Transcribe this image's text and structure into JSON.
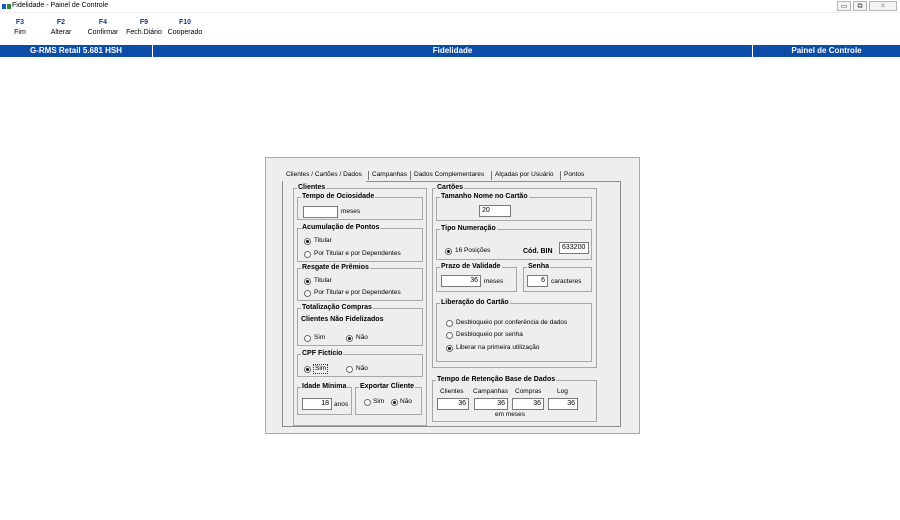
{
  "window": {
    "title": "Fidelidade - Painel de Controle",
    "minimize_glyph": "▭",
    "maximize_glyph": "⧉",
    "close_glyph": "✕"
  },
  "toolbar": {
    "keys": [
      {
        "key": "F3",
        "label": "Fim"
      },
      {
        "key": "F2",
        "label": "Alterar"
      },
      {
        "key": "F4",
        "label": "Confirmar"
      },
      {
        "key": "F9",
        "label": "Fech.Diário"
      },
      {
        "key": "F10",
        "label": "Cooperado"
      }
    ]
  },
  "statusbar": {
    "left": "G-RMS Retail 5.681 HSH",
    "center": "Fidelidade",
    "right": "Painel de Controle",
    "color": "#0d4da8"
  },
  "tabs": [
    "Clientes / Cartões / Dados",
    "Campanhas",
    "Dados Complementares",
    "Alçadas por Usuário",
    "Pontos"
  ],
  "clientes": {
    "legend": "Clientes",
    "ociosidade": {
      "legend": "Tempo de Ociosidade",
      "value": "",
      "unit": "meses"
    },
    "acumulacao": {
      "legend": "Acumulação de Pontos",
      "options": [
        "Titular",
        "Por Titular e por Dependentes"
      ],
      "selected": 0
    },
    "resgate": {
      "legend": "Resgate de Prêmios",
      "options": [
        "Titular",
        "Por Titular e por Dependentes"
      ],
      "selected": 0
    },
    "totalizacao": {
      "legend": "Totalização Compras",
      "sublabel": "Clientes Não Fidelizados",
      "options": [
        "Sim",
        "Não"
      ],
      "selected": 1
    },
    "cpf": {
      "legend": "CPF Fictício",
      "options": [
        "Sim",
        "Não"
      ],
      "selected": 0
    },
    "idade": {
      "legend": "Idade Mínima",
      "value": "18",
      "unit": "anos"
    },
    "exportar": {
      "legend": "Exportar Cliente",
      "options": [
        "Sim",
        "Não"
      ],
      "selected": 1
    }
  },
  "cartoes": {
    "legend": "Cartões",
    "tamanho": {
      "legend": "Tamanho Nome no Cartão",
      "value": "20"
    },
    "numeracao": {
      "legend": "Tipo Numeração",
      "option": "16 Posições",
      "selected": 0,
      "bin_label": "Cód. BIN",
      "bin_value": "633200"
    },
    "validade": {
      "legend": "Prazo de Validade",
      "value": "36",
      "unit": "meses"
    },
    "senha": {
      "legend": "Senha",
      "value": "6",
      "unit": "caracteres"
    },
    "liberacao": {
      "legend": "Liberação do Cartão",
      "options": [
        "Desbloqueio por conferência de dados",
        "Desbloqueio por senha",
        "Liberar na primeira utilização"
      ],
      "selected": 2
    }
  },
  "retencao": {
    "legend": "Tempo de Retenção Base de Dados",
    "columns": [
      "Clientes",
      "Campanhas",
      "Compras",
      "Log"
    ],
    "values": [
      "36",
      "36",
      "36",
      "36"
    ],
    "unit": "em meses"
  }
}
